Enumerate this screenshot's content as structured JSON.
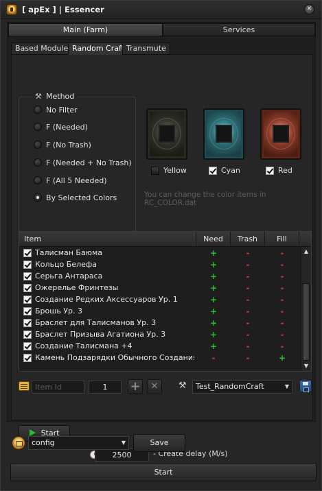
{
  "window": {
    "title": "[ apEx ] | Essencer",
    "close_glyph": "✕"
  },
  "main_tabs": [
    {
      "label": "Main (Farm)"
    },
    {
      "label": "Services"
    }
  ],
  "sub_tabs": [
    {
      "label": "Based Modules"
    },
    {
      "label": "Random Craft"
    },
    {
      "label": "Transmute"
    }
  ],
  "method": {
    "legend": "Method",
    "options": [
      {
        "label": "No Filter",
        "checked": false
      },
      {
        "label": "F (Needed)",
        "checked": false
      },
      {
        "label": "F (No Trash)",
        "checked": false
      },
      {
        "label": "F (Needed + No Trash)",
        "checked": false
      },
      {
        "label": "F (All 5 Needed)",
        "checked": false
      },
      {
        "label": "By Selected Colors",
        "checked": true
      }
    ]
  },
  "colors": [
    {
      "label": "Yellow",
      "checked": false
    },
    {
      "label": "Cyan",
      "checked": true
    },
    {
      "label": "Red",
      "checked": true
    }
  ],
  "hint": "You can change the color items in RC_COLOR.dat",
  "table": {
    "headers": {
      "item": "Item",
      "need": "Need",
      "trash": "Trash",
      "fill": "Fill"
    },
    "rows": [
      {
        "name": "Талисман Баюма",
        "need": "+",
        "trash": "-",
        "fill": "-"
      },
      {
        "name": "Кольцо Белефа",
        "need": "+",
        "trash": "-",
        "fill": "-"
      },
      {
        "name": "Серьга Антараса",
        "need": "+",
        "trash": "-",
        "fill": "-"
      },
      {
        "name": "Ожерелье Фринтезы",
        "need": "+",
        "trash": "-",
        "fill": "-"
      },
      {
        "name": "Создание Редких Аксессуаров Ур. 1",
        "need": "+",
        "trash": "-",
        "fill": "-"
      },
      {
        "name": "Брошь Ур. 3",
        "need": "+",
        "trash": "-",
        "fill": "-"
      },
      {
        "name": "Браслет для Талисманов Ур. 3",
        "need": "+",
        "trash": "-",
        "fill": "-"
      },
      {
        "name": "Браслет Призыва Агатиона Ур. 3",
        "need": "+",
        "trash": "-",
        "fill": "-"
      },
      {
        "name": "Создание Талисмана +4",
        "need": "+",
        "trash": "-",
        "fill": "-"
      },
      {
        "name": "Камень Подзарядки Обычного Создания - ...",
        "need": "-",
        "trash": "-",
        "fill": "+"
      }
    ]
  },
  "item_controls": {
    "item_id_placeholder": "Item Id",
    "quantity": "1",
    "add_glyph": "+",
    "remove_glyph": "✕",
    "preset": "Test_RandomCraft"
  },
  "run": {
    "start_label": "Start",
    "delay": "2500",
    "delay_label": "- Create delay (M/s)"
  },
  "footer": {
    "config": "config",
    "save_label": "Save",
    "start_label": "Start"
  }
}
